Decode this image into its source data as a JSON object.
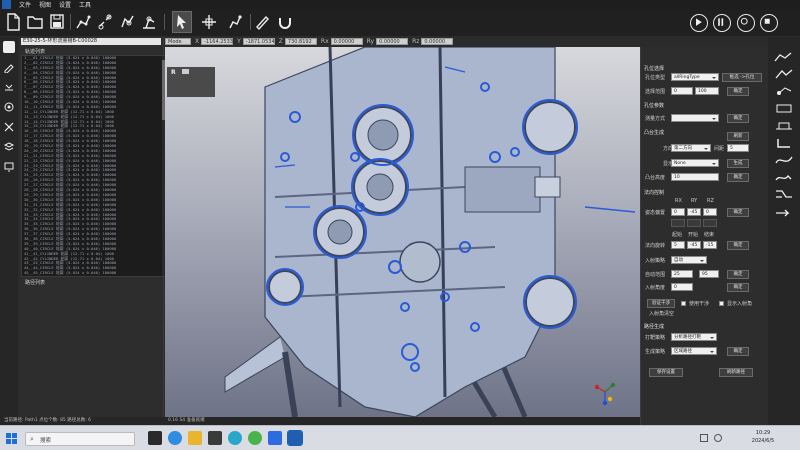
{
  "menubar": {
    "items": [
      "文件",
      "视图",
      "设置",
      "工具"
    ]
  },
  "left_panel": {
    "path_title": "E30-25-5-环形流量槽B-C00028",
    "track_label": "轨迹列表",
    "path_list_label": "路径列表",
    "tracks": [
      "1___01_CIRCLE 轮廓 (5.024 x 0.046) 100000",
      "2___02_CIRCLE 轮廓 (5.024 x 0.046) 100000",
      "3___03_CIRCLE 轮廓 (5.024 x 0.046) 100000",
      "4___04_CIRCLE 轮廓 (5.024 x 0.046) 100000",
      "5___05_CIRCLE 轮廓 (5.024 x 0.046) 100000",
      "6___06_CIRCLE 轮廓 (5.024 x 0.046) 100000",
      "7___07_CIRCLE 轮廓 (5.024 x 0.046) 100000",
      "8___08_CIRCLE 轮廓 (5.024 x 0.046) 100000",
      "9___09_CIRCLE 轮廓 (5.024 x 0.046) 100000",
      "10__10_CIRCLE 轮廓 (5.024 x 0.046) 100000",
      "11__11_CIRCLE 轮廓 (5.024 x 0.046) 100000",
      "12__12_CYLINDER 轮廓 (12.71 x 0.04) 1000",
      "13__13_CYLINDER 轮廓 (12.71 x 0.04) 1000",
      "14__14_CYLINDER 轮廓 (12.71 x 0.04) 1000",
      "15__15_CYLINDER 轮廓 (12.71 x 0.04) 1000",
      "16__16_CIRCLE 轮廓 (5.024 x 0.046) 100000",
      "17__17_CIRCLE 轮廓 (5.024 x 0.046) 100000",
      "18__18_CIRCLE 轮廓 (5.024 x 0.046) 100000",
      "19__19_CIRCLE 轮廓 (5.024 x 0.046) 100000",
      "20__20_CIRCLE 轮廓 (5.024 x 0.046) 100000",
      "21__21_CIRCLE 轮廓 (5.024 x 0.046) 100000",
      "22__22_CIRCLE 轮廓 (5.024 x 0.046) 100000",
      "23__23_CIRCLE 轮廓 (5.024 x 0.046) 100000",
      "24__24_CIRCLE 轮廓 (5.024 x 0.046) 100000",
      "25__25_CIRCLE 轮廓 (5.024 x 0.046) 100000",
      "26__26_CIRCLE 轮廓 (5.024 x 0.046) 100000",
      "27__27_CIRCLE 轮廓 (5.024 x 0.046) 100000",
      "28__28_CIRCLE 轮廓 (5.024 x 0.046) 100000",
      "29__29_CIRCLE 轮廓 (5.024 x 0.046) 100000",
      "30__30_CIRCLE 轮廓 (5.024 x 0.046) 100000",
      "31__31_CIRCLE 轮廓 (5.024 x 0.046) 100000",
      "32__32_CIRCLE 轮廓 (5.024 x 0.046) 100000",
      "33__33_CIRCLE 轮廓 (5.024 x 0.046) 100000",
      "34__34_CIRCLE 轮廓 (5.024 x 0.046) 100000",
      "35__35_CIRCLE 轮廓 (5.024 x 0.046) 100000",
      "36__36_CIRCLE 轮廓 (5.024 x 0.046) 100000",
      "37__37_CIRCLE 轮廓 (5.024 x 0.046) 100000",
      "38__38_CIRCLE 轮廓 (5.024 x 0.046) 100000",
      "39__39_CIRCLE 轮廓 (5.024 x 0.046) 100000",
      "40__40_CIRCLE 轮廓 (5.024 x 0.046) 100000",
      "41__41_CYLINDER 轮廓 (12.71 x 0.04) 1000",
      "42__42_CYLINDER 轮廓 (12.71 x 0.04) 1000",
      "43__43_CIRCLE 轮廓 (5.024 x 0.046) 100000",
      "44__44_CIRCLE 轮廓 (5.024 x 0.046) 100000",
      "45__45_CIRCLE 轮廓 (5.024 x 0.046) 100000"
    ]
  },
  "status": {
    "left": "当前路径: Path1    点位个数: 85    路径总数: 6",
    "right": "0.16 S4  准备就绪"
  },
  "coordbar": {
    "mode": "Mode",
    "fields": [
      {
        "label": "X",
        "value": "-1164.2533"
      },
      {
        "label": "Y",
        "value": "-1871.0534"
      },
      {
        "label": "Z",
        "value": "730.8192"
      },
      {
        "label": "Rx",
        "value": "0.00000"
      },
      {
        "label": "Ry",
        "value": "0.00000"
      },
      {
        "label": "Rz",
        "value": "0.00000"
      }
    ]
  },
  "right_panel": {
    "sec_select": "孔位选择",
    "hole_type_label": "孔位类型",
    "hole_type_value": "allRingType",
    "btn_select": "框选 ->孔位",
    "range_label": "选择范围",
    "range_min": "0",
    "range_max": "100",
    "confirm": "确定",
    "sec_measure": "孔位参数",
    "measure_mode_label": "测量方式",
    "sec_boss": "凸台生成",
    "refresh": "刷新",
    "direction_label": "方向",
    "direction_value": "第二方向",
    "spacing_label": "间距",
    "spacing_value": "5",
    "display_label": "显示",
    "display_value": "None",
    "generate": "生成",
    "boss_height_label": "凸台高度",
    "boss_height_value": "10",
    "sec_direction": "法向控制",
    "col_rx": "RX",
    "col_ry": "RY",
    "col_rz": "RZ",
    "angle_offset_label": "姿态偏置",
    "angle_offset": [
      "0",
      "-45",
      "0"
    ],
    "col_start": "起始",
    "col_open": "开始",
    "col_end": "结束",
    "rotate_label": "法向旋转",
    "rotate_values": [
      "5",
      "-45",
      "-15"
    ],
    "sec_entry": "入射策略",
    "entry_mode_value": "自动",
    "auto_range_label": "自动范围",
    "auto_range": [
      "25",
      "95"
    ],
    "entry_angle_label": "入射角度",
    "entry_angle_value": "0",
    "verify_btn": "验证干涉",
    "chk_use_collision": "使用干涉",
    "chk_show_entry": "显示入射角",
    "entry_clear_label": "入射角清空",
    "sec_path": "路径生成",
    "print_policy_label": "打靶策略",
    "print_policy_value": "分析路径打靶",
    "gen_policy_label": "生成策略",
    "gen_policy_value": "区域路径",
    "path_confirm": "确定",
    "btn_save": "保存设置",
    "btn_gen_path": "刷新路径"
  },
  "view": {
    "mini_label": "R"
  },
  "taskbar": {
    "search_placeholder": "搜索",
    "time": "10:29",
    "date": "2024/6/5"
  },
  "colors": {
    "accent": "#2a5bd7",
    "part": "#aeb9cf"
  }
}
